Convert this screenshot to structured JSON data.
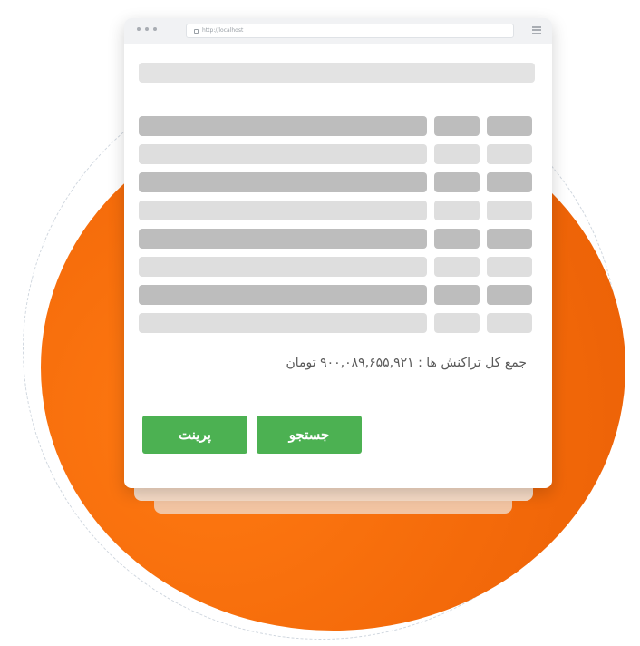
{
  "browser": {
    "url": "http://localhost"
  },
  "table": {
    "rows": [
      {
        "style": "dark"
      },
      {
        "style": "light"
      },
      {
        "style": "dark"
      },
      {
        "style": "light"
      },
      {
        "style": "dark"
      },
      {
        "style": "light"
      },
      {
        "style": "dark"
      },
      {
        "style": "light"
      }
    ]
  },
  "summary": {
    "total_text": "جمع کل تراکنش ها : ۹۰۰,۰۸۹,۶۵۵,۹۲۱ تومان"
  },
  "actions": {
    "search_label": "جستجو",
    "print_label": "پرینت"
  },
  "colors": {
    "accent_orange": "#f46a0a",
    "button_green": "#4cb152"
  }
}
